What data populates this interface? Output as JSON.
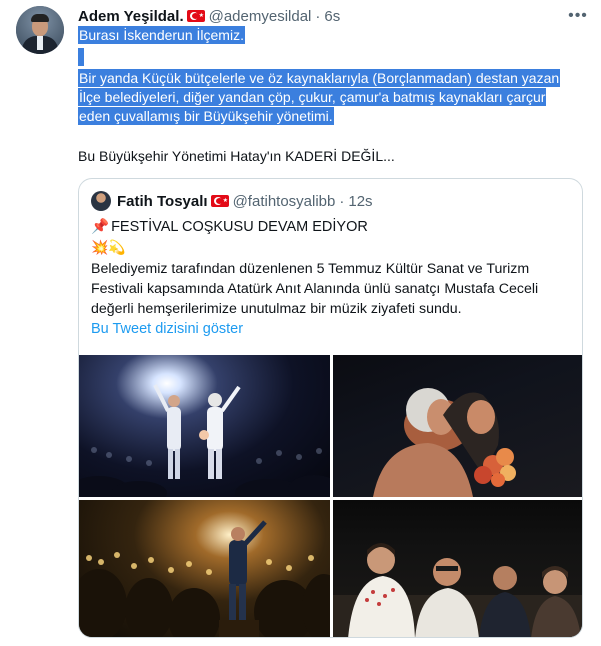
{
  "tweet": {
    "author_name": "Adem Yeşildal.",
    "handle": "@ademyesildal",
    "separator": "·",
    "time": "6s",
    "more_icon": "more-dots-icon",
    "lines": [
      "Burası İskenderun İlçemiz.",
      "",
      "Bir yanda Küçük bütçelerle ve öz kaynaklarıyla (Borçlanmadan) destan yazan",
      "İlçe belediyeleri, diğer yandan çöp, çukur, çamur'a batmış kaynakları çarçur",
      "eden çuvallamış bir Büyükşehir yönetimi.",
      "",
      "Bu Büyükşehir Yönetimi Hatay'ın KADERİ DEĞİL..."
    ],
    "selection_color": "#3b7fde"
  },
  "quoted": {
    "author_name": "Fatih Tosyalı",
    "handle": "@fatihtosyalibb",
    "separator": "·",
    "time": "12s",
    "title": "FESTİVAL COŞKUSU DEVAM EDİYOR",
    "pin_emoji": "📌",
    "emojis": "💥💫",
    "body_lines": [
      "Belediyemiz tarafından düzenlenen 5 Temmuz Kültür Sanat ve Turizm",
      "Festivali kapsamında Atatürk Anıt Alanında ünlü sanatçı Mustafa Ceceli",
      "değerli hemşerilerimize unutulmaz bir müzik ziyafeti sundu."
    ],
    "show_thread": "Bu Tweet dizisini göster",
    "link_color": "#1d9bf0"
  },
  "media": {
    "photos": [
      "concert-stage-waving-photo",
      "embrace-with-flowers-photo",
      "singer-crowd-photo",
      "audience-seated-officials-photo"
    ]
  }
}
